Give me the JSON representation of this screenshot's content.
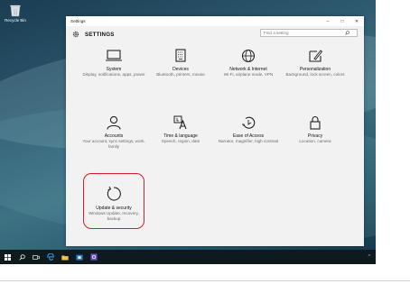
{
  "desktop": {
    "recycle_bin_label": "Recycle Bin"
  },
  "window": {
    "title": "Settings",
    "controls": {
      "minimize": "–",
      "maximize": "□",
      "close": "✕"
    }
  },
  "header": {
    "title": "SETTINGS",
    "search_placeholder": "Find a setting"
  },
  "tiles": [
    {
      "title": "System",
      "desc": "Display, notifications, apps, power",
      "icon": "laptop-icon"
    },
    {
      "title": "Devices",
      "desc": "Bluetooth, printers, mouse",
      "icon": "keyboard-icon"
    },
    {
      "title": "Network & Internet",
      "desc": "Wi-Fi, airplane mode, VPN",
      "icon": "globe-icon"
    },
    {
      "title": "Personalization",
      "desc": "Background, lock screen, colors",
      "icon": "paint-icon"
    },
    {
      "title": "Accounts",
      "desc": "Your account, sync settings, work, family",
      "icon": "person-icon"
    },
    {
      "title": "Time & language",
      "desc": "Speech, region, date",
      "icon": "time-language-icon"
    },
    {
      "title": "Ease of Access",
      "desc": "Narrator, magnifier, high contrast",
      "icon": "ease-of-access-icon"
    },
    {
      "title": "Privacy",
      "desc": "Location, camera",
      "icon": "lock-icon"
    },
    {
      "title": "Update & security",
      "desc": "Windows Update, recovery, backup",
      "icon": "update-icon"
    }
  ],
  "taskbar": {
    "items": [
      "start-icon",
      "search-icon",
      "task-view-icon",
      "edge-icon",
      "file-explorer-icon",
      "store-icon",
      "app-icon"
    ],
    "tray_caret": "^"
  },
  "colors": {
    "accent": "#0078d7",
    "highlight": "#d81e2a"
  }
}
